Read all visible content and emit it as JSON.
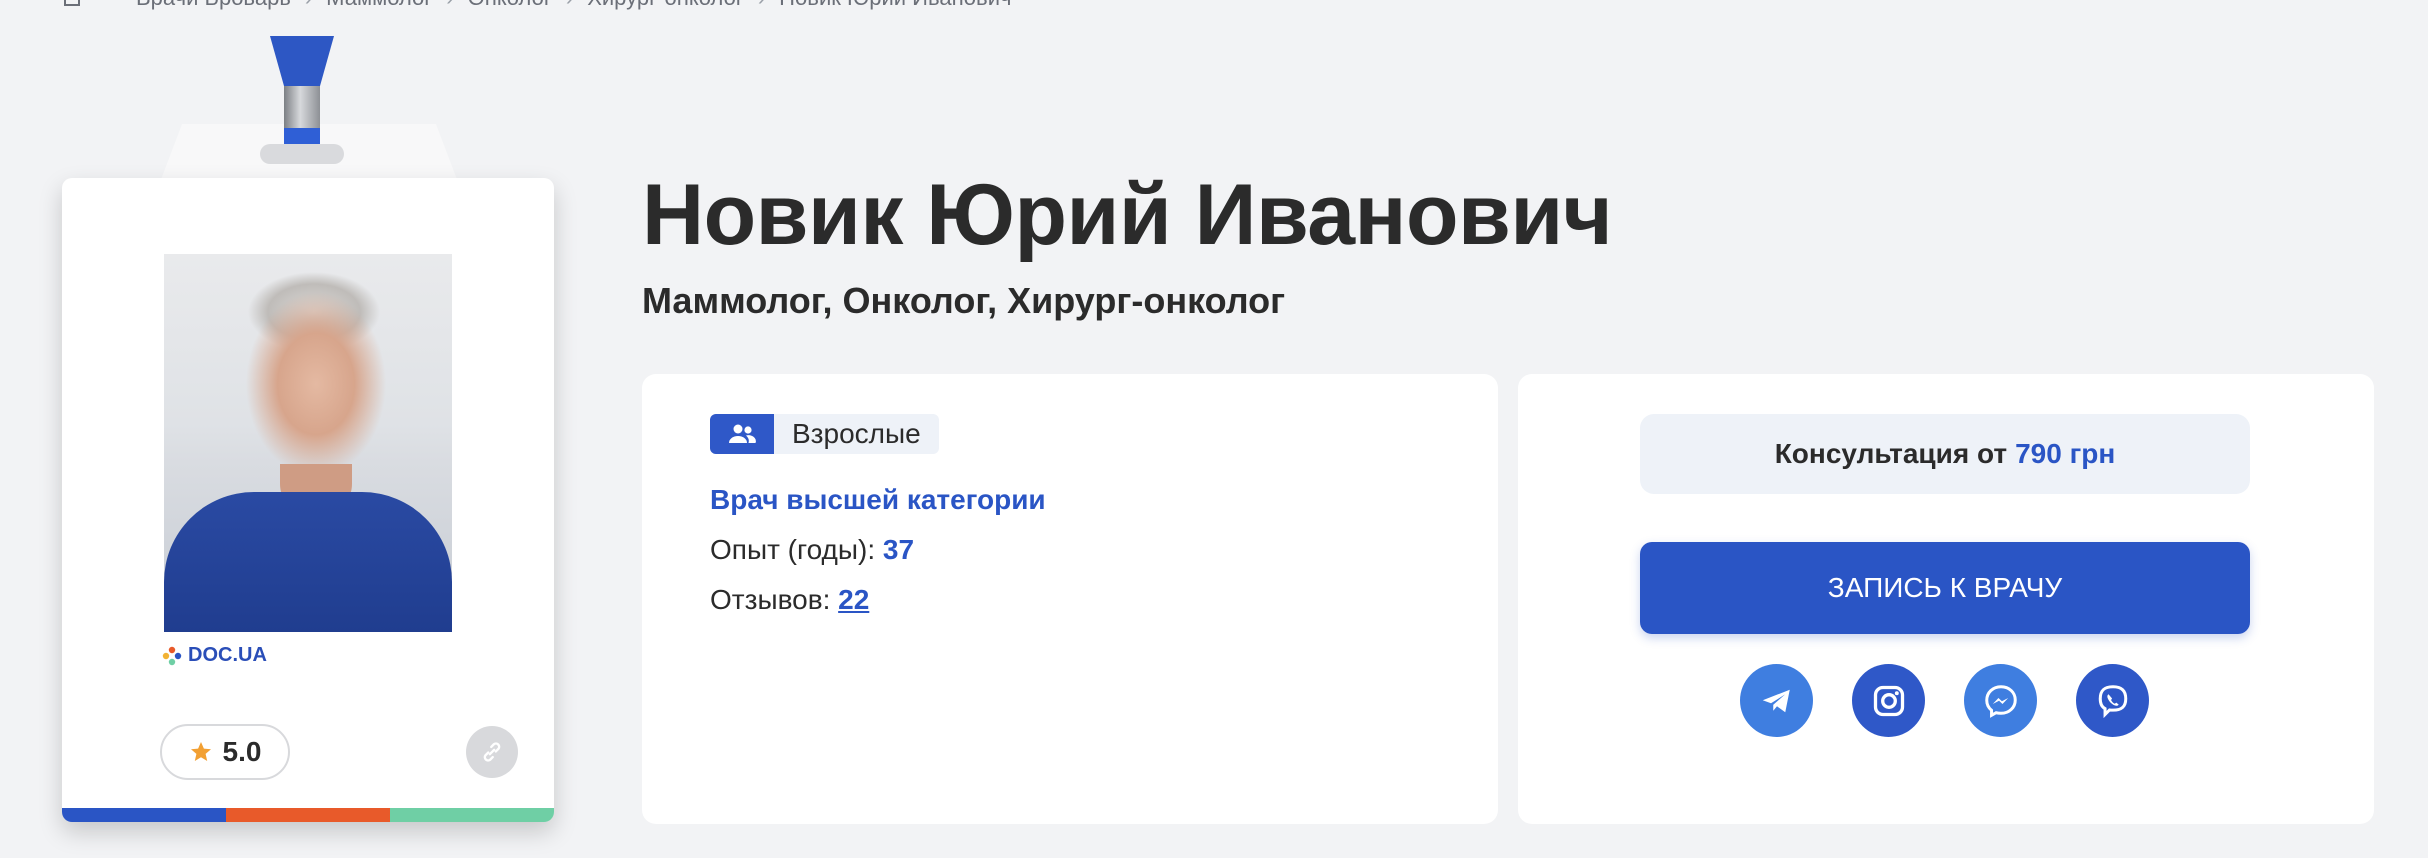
{
  "breadcrumb": {
    "items": [
      "Врачи Броварь",
      "Маммолог",
      "Онколог",
      "Хирург-онколог",
      "Новик Юрий Иванович"
    ],
    "separator": "›"
  },
  "doctor": {
    "name": "Новик Юрий Иванович",
    "specialties": "Маммолог, Онколог, Хирург-онколог",
    "patient_group": "Взрослые",
    "category": "Врач высшей категории",
    "experience_label": "Опыт (годы):",
    "experience_value": "37",
    "reviews_label": "Отзывов:",
    "reviews_value": "22",
    "rating": "5.0"
  },
  "badge": {
    "source_logo_text": "DOC.UA",
    "stripe_colors": [
      "#2a55c5",
      "#e85a2a",
      "#6fcfa5"
    ]
  },
  "booking": {
    "price_prefix": "Консультация от",
    "price": "790 грн",
    "button_label": "ЗАПИСЬ К ВРАЧУ"
  },
  "socials": [
    {
      "name": "telegram-icon",
      "color": "#3f7ee0"
    },
    {
      "name": "instagram-icon",
      "color": "#2f58c8"
    },
    {
      "name": "messenger-icon",
      "color": "#3f7ee0"
    },
    {
      "name": "viber-icon",
      "color": "#2f58c8"
    }
  ],
  "colors": {
    "accent": "#2a55c5",
    "background": "#f2f3f5",
    "panel": "#ffffff",
    "text": "#2b2b2b"
  }
}
